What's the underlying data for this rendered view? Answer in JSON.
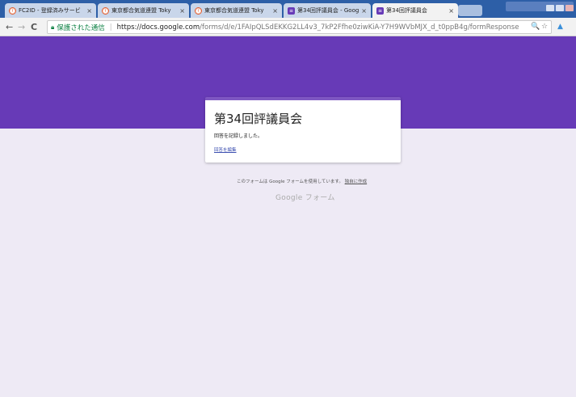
{
  "browser": {
    "tabs": [
      {
        "title": "FC2ID - 登録済みサービ",
        "favicon": "fc2-icon",
        "active": false
      },
      {
        "title": "東京都合気道連盟 Toky",
        "favicon": "fc2-icon",
        "active": false
      },
      {
        "title": "東京都合気道連盟 Toky",
        "favicon": "fc2-icon",
        "active": false
      },
      {
        "title": "第34回評議員会 - Goog",
        "favicon": "forms-icon",
        "active": false
      },
      {
        "title": "第34回評議員会",
        "favicon": "forms-icon",
        "active": true
      }
    ],
    "close_glyph": "×",
    "nav": {
      "back": "←",
      "forward": "→",
      "reload": "C"
    },
    "secure_label": "保護された通信",
    "url_host": "https://docs.google.com",
    "url_path": "/forms/d/e/1FAIpQLSdEKKG2LL4v3_7kP2Ffhe0ziwKiA-Y7H9WVbMJX_d_t0ppB4g/formResponse",
    "zoom_icon": "🔍",
    "star_icon": "☆"
  },
  "form": {
    "title": "第34回評議員会",
    "confirmation": "回答を記録しました。",
    "edit_link": "回答を編集"
  },
  "footer": {
    "note": "このフォームは Google フォームを使用しています。",
    "create_link": "独自に作成",
    "brand": "Google フォーム"
  },
  "colors": {
    "banner": "#673ab7",
    "background": "#eeeaf5",
    "accent": "#7e57c2"
  }
}
